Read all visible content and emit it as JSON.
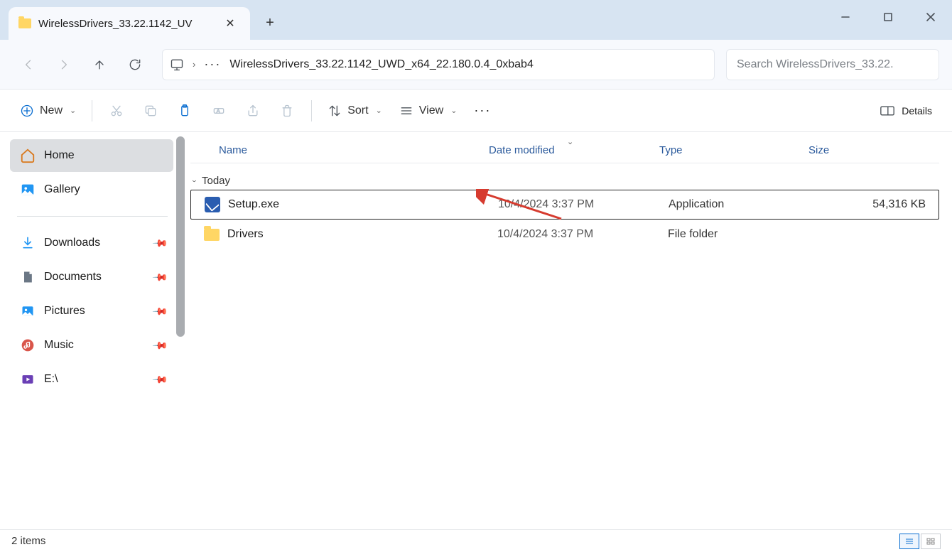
{
  "tab": {
    "title": "WirelessDrivers_33.22.1142_UV"
  },
  "address": {
    "path": "WirelessDrivers_33.22.1142_UWD_x64_22.180.0.4_0xbab4"
  },
  "search": {
    "placeholder": "Search WirelessDrivers_33.22."
  },
  "toolbar": {
    "new": "New",
    "sort": "Sort",
    "view": "View",
    "details": "Details"
  },
  "sidebar": {
    "items": [
      {
        "label": "Home"
      },
      {
        "label": "Gallery"
      },
      {
        "label": "Downloads"
      },
      {
        "label": "Documents"
      },
      {
        "label": "Pictures"
      },
      {
        "label": "Music"
      },
      {
        "label": "E:\\"
      }
    ]
  },
  "columns": {
    "name": "Name",
    "date": "Date modified",
    "type": "Type",
    "size": "Size"
  },
  "group": "Today",
  "files": [
    {
      "name": "Setup.exe",
      "date": "10/4/2024 3:37 PM",
      "type": "Application",
      "size": "54,316 KB",
      "icon": "exe",
      "selected": true
    },
    {
      "name": "Drivers",
      "date": "10/4/2024 3:37 PM",
      "type": "File folder",
      "size": "",
      "icon": "folder",
      "selected": false
    }
  ],
  "status": {
    "count": "2 items"
  }
}
